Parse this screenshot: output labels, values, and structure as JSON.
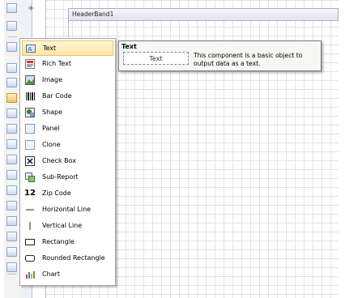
{
  "band": {
    "header_title": "HeaderBand1"
  },
  "menu": {
    "items": [
      {
        "label": "Text",
        "icon": "text-icon"
      },
      {
        "label": "Rich Text",
        "icon": "rich-text-icon"
      },
      {
        "label": "Image",
        "icon": "image-icon"
      },
      {
        "label": "Bar Code",
        "icon": "barcode-icon"
      },
      {
        "label": "Shape",
        "icon": "shape-icon"
      },
      {
        "label": "Panel",
        "icon": "panel-icon"
      },
      {
        "label": "Clone",
        "icon": "clone-icon"
      },
      {
        "label": "Check Box",
        "icon": "checkbox-icon"
      },
      {
        "label": "Sub-Report",
        "icon": "subreport-icon"
      },
      {
        "label": "Zip Code",
        "icon": "zipcode-icon"
      },
      {
        "label": "Horizontal Line",
        "icon": "horizontal-line-icon"
      },
      {
        "label": "Vertical Line",
        "icon": "vertical-line-icon"
      },
      {
        "label": "Rectangle",
        "icon": "rectangle-icon"
      },
      {
        "label": "Rounded Rectangle",
        "icon": "rounded-rectangle-icon"
      },
      {
        "label": "Chart",
        "icon": "chart-icon"
      }
    ],
    "highlighted": "Text",
    "zip_code_glyph": "12"
  },
  "tooltip": {
    "title": "Text",
    "preview": "Text",
    "description": "This component is a basic object to output data as a text."
  },
  "colors": {
    "highlight": "#ffe6a3",
    "toolbar": "#f3f3f3",
    "grid": "#e2e2e2"
  }
}
